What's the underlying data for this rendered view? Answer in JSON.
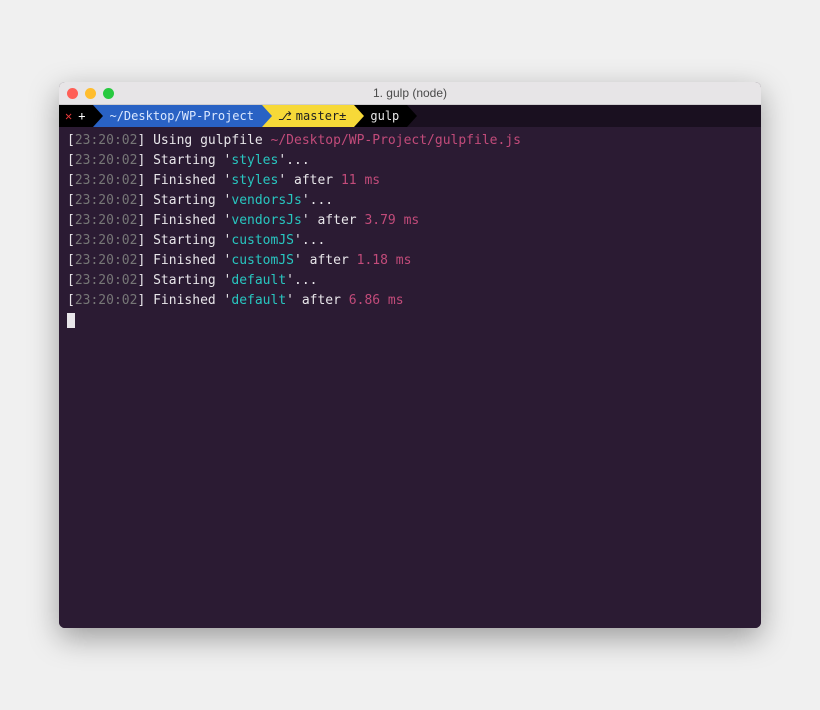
{
  "window": {
    "title": "1. gulp (node)"
  },
  "prompt": {
    "close_symbol": "✕",
    "plus_symbol": "+",
    "cwd": "~/Desktop/WP-Project",
    "branch_icon": "⎇",
    "branch": "master±",
    "command": "gulp"
  },
  "timestamp": "23:20:02",
  "lines": [
    {
      "type": "using",
      "text_before": "Using gulpfile ",
      "path": "~/Desktop/WP-Project/gulpfile.js"
    },
    {
      "type": "start",
      "task": "styles"
    },
    {
      "type": "finish",
      "task": "styles",
      "ms": "11 ms"
    },
    {
      "type": "start",
      "task": "vendorsJs"
    },
    {
      "type": "finish",
      "task": "vendorsJs",
      "ms": "3.79 ms"
    },
    {
      "type": "start",
      "task": "customJS"
    },
    {
      "type": "finish",
      "task": "customJS",
      "ms": "1.18 ms"
    },
    {
      "type": "start",
      "task": "default"
    },
    {
      "type": "finish",
      "task": "default",
      "ms": "6.86 ms"
    }
  ],
  "words": {
    "starting": "Starting",
    "finished": "Finished",
    "after": "after",
    "dots": "..."
  }
}
